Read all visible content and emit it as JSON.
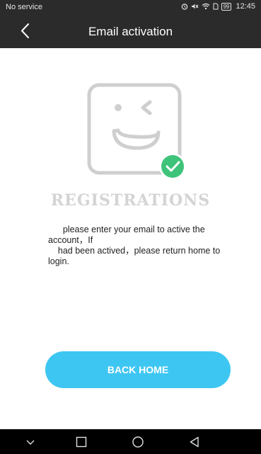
{
  "status_bar": {
    "carrier": "No service",
    "battery": "99",
    "time": "12:45",
    "icons": [
      "alarm-icon",
      "mute-icon",
      "wifi-icon",
      "sim-icon",
      "battery-icon"
    ]
  },
  "header": {
    "title": "Email activation",
    "back_icon": "chevron-left-icon"
  },
  "illustration": {
    "icon": "winking-face-check-icon",
    "word": "REGISTRATIONS",
    "check_color": "#3ec37a"
  },
  "message": {
    "lines": [
      "      please enter your email to active the",
      "account，If",
      "    had been actived，please return home to",
      "login."
    ]
  },
  "actions": {
    "back_home_label": "BACK HOME",
    "accent_color": "#3ec6f2"
  },
  "nav_bar": {
    "buttons": [
      "chevron-down-icon",
      "recents-icon",
      "home-icon",
      "back-triangle-icon"
    ]
  }
}
